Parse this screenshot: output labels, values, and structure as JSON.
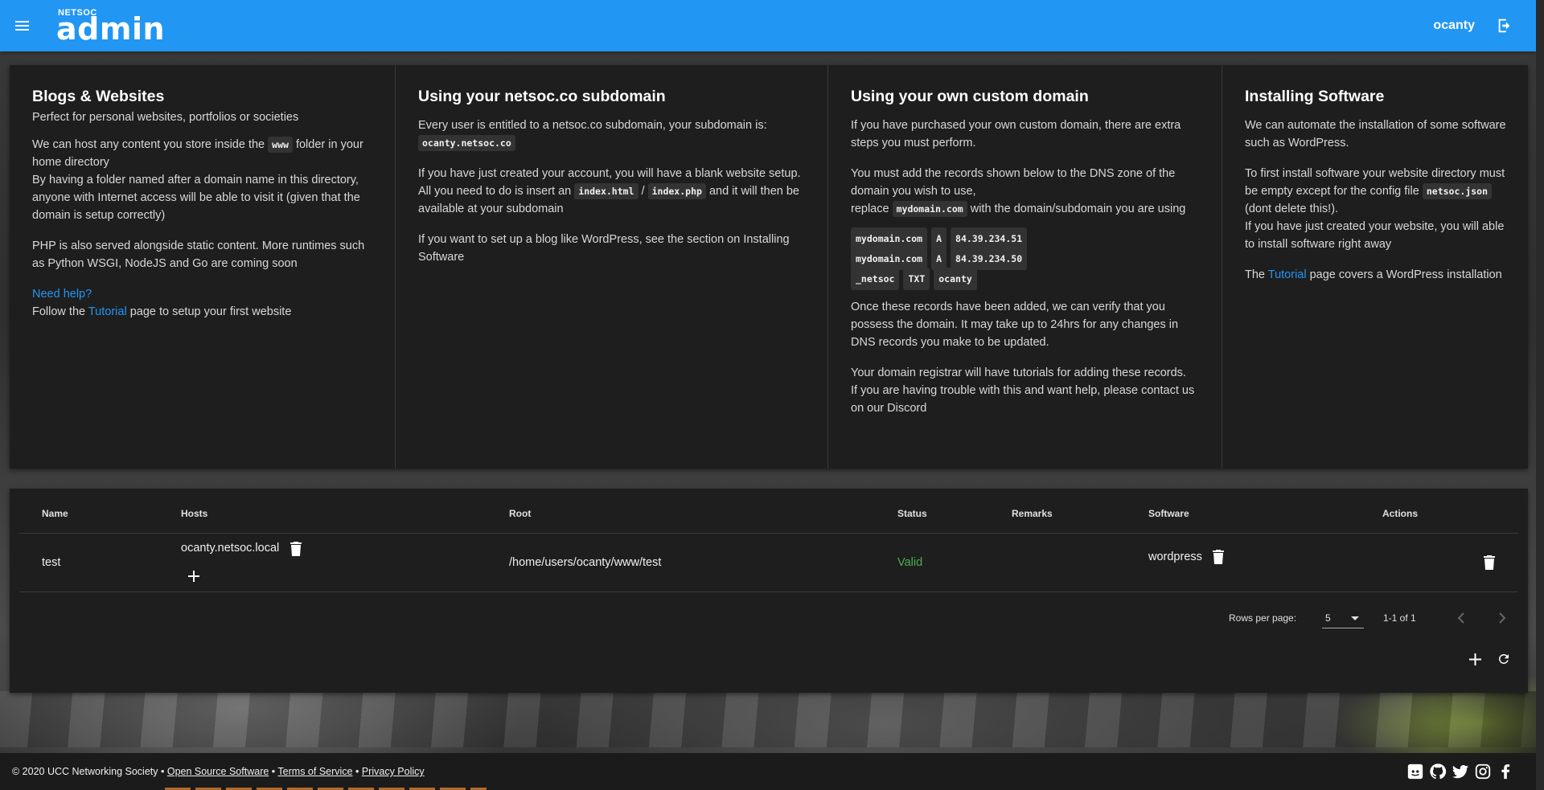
{
  "app": {
    "brand_small": "NETSOC",
    "brand_big": "admin",
    "username": "ocanty"
  },
  "info": {
    "blogs": {
      "title": "Blogs & Websites",
      "subtitle": "Perfect for personal websites, portfolios or societies",
      "p1_pre": "We can host any content you store inside the ",
      "p1_code": "www",
      "p1_post": " folder in your home directory",
      "p1b": "By having a folder named after a domain name in this directory, anyone with Internet access will be able to visit it (given that the domain is setup correctly)",
      "p2": "PHP is also served alongside static content. More runtimes such as Python WSGI, NodeJS and Go are coming soon",
      "help_link": "Need help?",
      "follow_pre": "Follow the ",
      "follow_link": "Tutorial",
      "follow_post": " page to setup your first website"
    },
    "subdomain": {
      "title": "Using your netsoc.co subdomain",
      "p1": "Every user is entitled to a netsoc.co subdomain, your subdomain is:",
      "p1_code": "ocanty.netsoc.co",
      "p2_pre": "If you have just created your account, you will have a blank website setup. All you need to do is insert an ",
      "p2_code1": "index.html",
      "p2_sep": " / ",
      "p2_code2": "index.php",
      "p2_post": " and it will then be available at your subdomain",
      "p3": "If you want to set up a blog like WordPress, see the section on Installing Software"
    },
    "custom": {
      "title": "Using your own custom domain",
      "p1": "If you have purchased your own custom domain, there are extra steps you must perform.",
      "p2": "You must add the records shown below to the DNS zone of the domain you wish to use,",
      "p2b_pre": "replace ",
      "p2b_code": "mydomain.com",
      "p2b_post": " with the domain/subdomain you are using",
      "records": [
        {
          "name": "mydomain.com",
          "type": "A",
          "value": "84.39.234.51"
        },
        {
          "name": "mydomain.com",
          "type": "A",
          "value": "84.39.234.50"
        },
        {
          "name": "_netsoc",
          "type": "TXT",
          "value": "ocanty"
        }
      ],
      "p3": "Once these records have been added, we can verify that you possess the domain. It may take up to 24hrs for any changes in DNS records you make to be updated.",
      "p4": "Your domain registrar will have tutorials for adding these records.",
      "p4b": "If you are having trouble with this and want help, please contact us on our Discord"
    },
    "software": {
      "title": "Installing Software",
      "p1": "We can automate the installation of some software such as WordPress.",
      "p2_pre": "To first install software your website directory must be empty except for the config file ",
      "p2_code": "netsoc.json",
      "p2_post": " (dont delete this!).",
      "p2b": "If you have just created your website, you will able to install software right away",
      "p3_pre": "The ",
      "p3_link": "Tutorial",
      "p3_post": " page covers a WordPress installation"
    }
  },
  "table": {
    "headers": {
      "name": "Name",
      "hosts": "Hosts",
      "root": "Root",
      "status": "Status",
      "remarks": "Remarks",
      "software": "Software",
      "actions": "Actions"
    },
    "rows": [
      {
        "name": "test",
        "host": "ocanty.netsoc.local",
        "root": "/home/users/ocanty/www/test",
        "status": "Valid",
        "remarks": "",
        "software": "wordpress"
      }
    ],
    "rows_per_page_label": "Rows per page:",
    "rows_per_page": "5",
    "range": "1-1 of 1"
  },
  "footer": {
    "copyright": "© 2020 UCC Networking Society • ",
    "link_oss": "Open Source Software",
    "sep1": " • ",
    "link_tos": "Terms of Service",
    "sep2": " • ",
    "link_privacy": "Privacy Policy",
    "social_icons": [
      "discord-icon",
      "github-icon",
      "twitter-icon",
      "instagram-icon",
      "facebook-icon"
    ]
  },
  "colors": {
    "appbar": "#2196f3",
    "card": "#1e1e1e",
    "link": "#2196f3",
    "status_valid": "#4caf50"
  }
}
